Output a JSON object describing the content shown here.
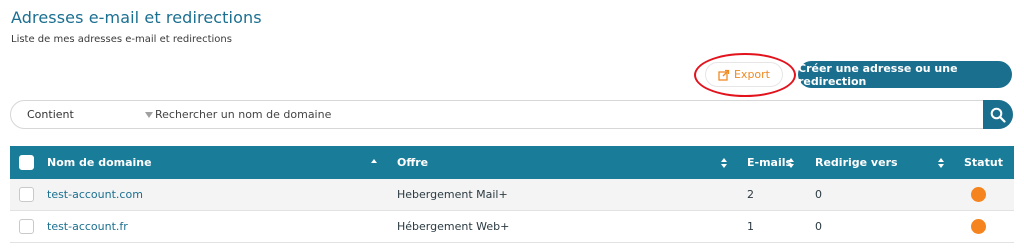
{
  "header": {
    "title": "Adresses e-mail et redirections",
    "subtitle": "Liste de mes adresses e-mail et redirections"
  },
  "toolbar": {
    "export_label": "Export",
    "create_label": "Créer une adresse ou une redirection",
    "annotation_color": "#e2131d",
    "export_color": "#ef8a23",
    "accent_color": "#1a6f8f"
  },
  "search": {
    "filter_value": "Contient",
    "placeholder": "Rechercher un nom de domaine"
  },
  "table": {
    "columns": {
      "domain": "Nom de domaine",
      "offer": "Offre",
      "emails": "E-mails",
      "redirects": "Redirige vers",
      "status": "Statut"
    },
    "rows": [
      {
        "domain": "test-account.com",
        "offer": "Hebergement Mail+",
        "emails": "2",
        "redirects": "0",
        "status_color": "#f5841f"
      },
      {
        "domain": "test-account.fr",
        "offer": "Hébergement Web+",
        "emails": "1",
        "redirects": "0",
        "status_color": "#f5841f"
      }
    ]
  }
}
